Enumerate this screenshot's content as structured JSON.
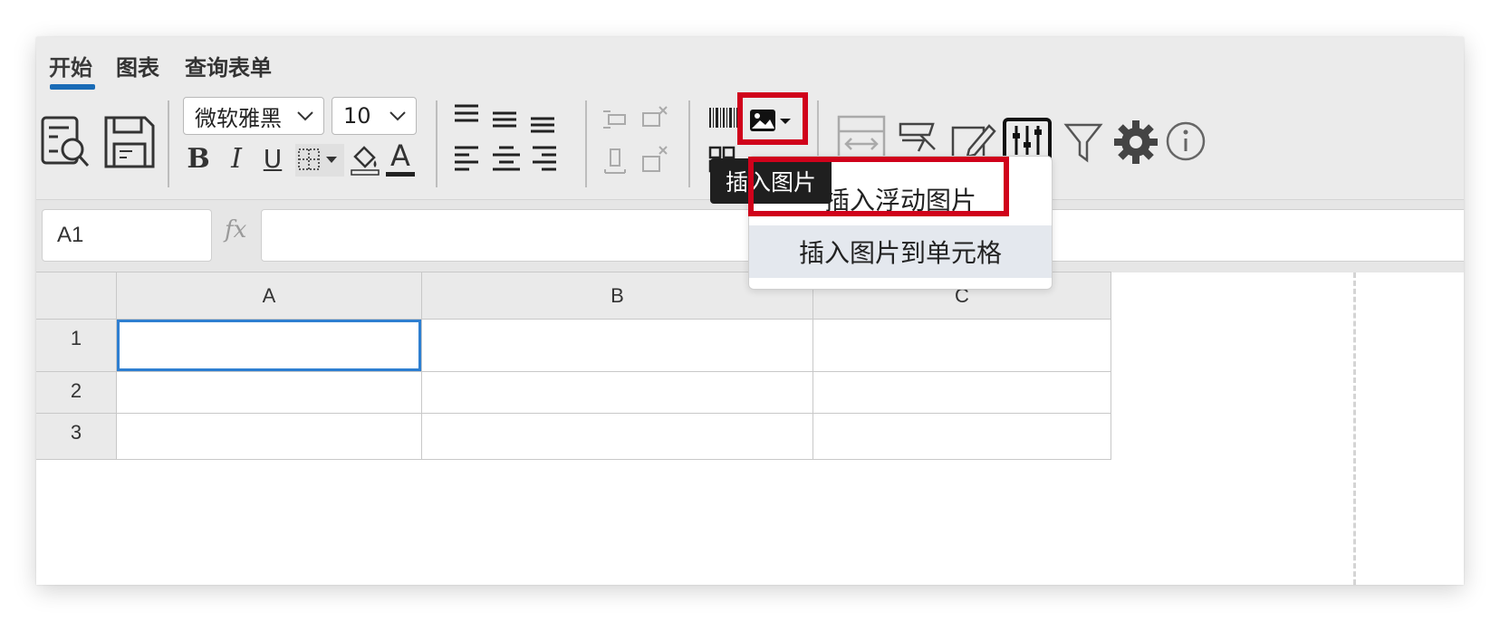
{
  "tabs": [
    {
      "label": "开始",
      "active": true
    },
    {
      "label": "图表",
      "active": false
    },
    {
      "label": "查询表单",
      "active": false
    }
  ],
  "toolbar": {
    "font_family": "微软雅黑",
    "font_size": "10",
    "bold_label": "B",
    "italic_label": "I",
    "underline_label": "U",
    "font_color_label": "A",
    "icons": [
      "preview-icon",
      "save-icon",
      "bold-icon",
      "italic-icon",
      "underline-icon",
      "border-icon",
      "fill-color-icon",
      "font-color-icon",
      "align-top-icon",
      "align-middle-icon",
      "align-bottom-icon",
      "align-left-icon",
      "align-center-icon",
      "align-right-icon",
      "insert-row-icon",
      "delete-row-icon",
      "insert-col-icon",
      "delete-col-icon",
      "barcode-icon",
      "qrcode-icon",
      "image-icon",
      "column-width-icon",
      "chart-icon",
      "edit-icon",
      "settings-sliders-icon",
      "filter-icon",
      "gear-icon",
      "info-icon"
    ]
  },
  "tooltip": {
    "text": "插入图片"
  },
  "dropdown": {
    "items": [
      {
        "label": "插入浮动图片",
        "highlighted": false
      },
      {
        "label": "插入图片到单元格",
        "highlighted": true
      }
    ]
  },
  "formula_bar": {
    "cell_ref": "A1",
    "fx_label": "fx",
    "formula": ""
  },
  "sheet": {
    "columns": [
      "A",
      "B",
      "C"
    ],
    "rows": [
      "1",
      "2",
      "3"
    ],
    "selected_cell": "A1"
  },
  "colors": {
    "accent": "#1a6bb6",
    "highlight": "#d0021b",
    "selection": "#2e7fd1"
  }
}
